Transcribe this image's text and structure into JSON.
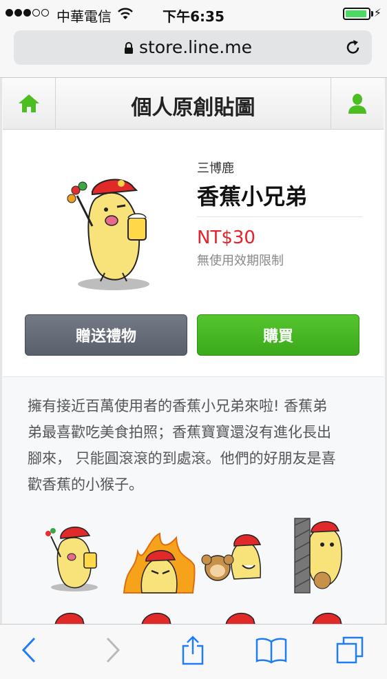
{
  "status_bar": {
    "carrier": "中華電信",
    "time": "下午6:35",
    "battery_level": 0.95
  },
  "browser": {
    "url": "store.line.me"
  },
  "header": {
    "title": "個人原創貼圖"
  },
  "product": {
    "author": "三博鹿",
    "name": "香蕉小兄弟",
    "price": "NT$30",
    "validity": "無使用效期限制",
    "gift_label": "贈送禮物",
    "buy_label": "購買"
  },
  "description": {
    "lines": [
      "擁有接近百萬使用者的香蕉小兄弟來啦! 香蕉弟",
      "弟最喜歡吃美食拍照；香蕉寶寶還沒有進化長出",
      "腳來， 只能圓滾滾的到處滾。他們的好朋友是喜",
      "歡香蕉的小猴子。"
    ]
  },
  "stickers": [
    {
      "name": "sticker-banana-beer"
    },
    {
      "name": "sticker-banana-angry-fire"
    },
    {
      "name": "sticker-banana-monkey-laugh"
    },
    {
      "name": "sticker-banana-peek-wall"
    }
  ],
  "colors": {
    "accent_green": "#3ba91b",
    "price_red": "#e8212b",
    "gift_gray": "#59606b",
    "ios_blue": "#1e7df5"
  },
  "icons": [
    "home-icon",
    "user-icon",
    "lock-icon",
    "reload-icon",
    "back-icon",
    "forward-icon",
    "share-icon",
    "bookmarks-icon",
    "tabs-icon"
  ]
}
